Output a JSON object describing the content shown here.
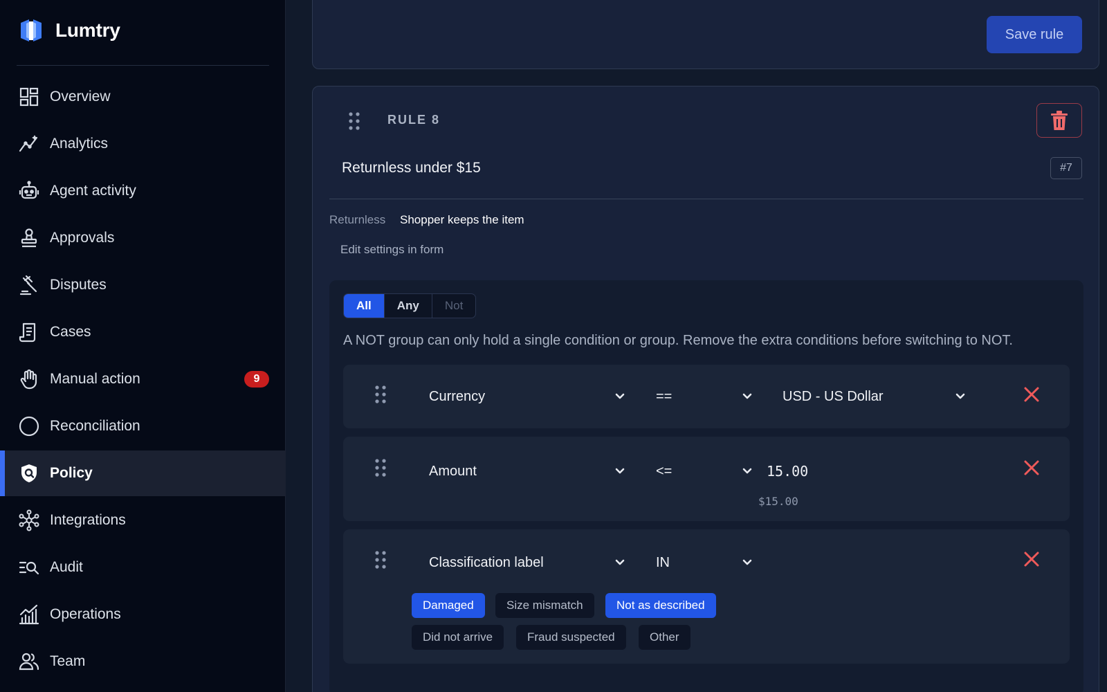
{
  "app": {
    "name": "Lumtry"
  },
  "nav": [
    {
      "label": "Overview",
      "icon": "overview-icon"
    },
    {
      "label": "Analytics",
      "icon": "analytics-icon"
    },
    {
      "label": "Agent activity",
      "icon": "robot-icon"
    },
    {
      "label": "Approvals",
      "icon": "stamp-icon"
    },
    {
      "label": "Disputes",
      "icon": "gavel-icon"
    },
    {
      "label": "Cases",
      "icon": "receipt-icon"
    },
    {
      "label": "Manual action",
      "icon": "hand-icon",
      "badge": "9"
    },
    {
      "label": "Reconciliation",
      "icon": "circle-icon"
    },
    {
      "label": "Policy",
      "icon": "shield-icon",
      "active": true
    },
    {
      "label": "Integrations",
      "icon": "network-icon"
    },
    {
      "label": "Audit",
      "icon": "audit-search-icon"
    },
    {
      "label": "Operations",
      "icon": "bar-chart-icon"
    },
    {
      "label": "Team",
      "icon": "users-icon"
    }
  ],
  "toolbar": {
    "save_label": "Save rule"
  },
  "rule": {
    "number_label": "RULE 8",
    "name": "Returnless under $15",
    "id_tag": "#7",
    "action_key": "Returnless",
    "action_value": "Shopper keeps the item",
    "edit_link": "Edit settings in form",
    "group_modes": [
      "All",
      "Any",
      "Not"
    ],
    "selected_mode": "All",
    "warning": "A NOT group can only hold a single condition or group. Remove the extra conditions before switching to NOT.",
    "conditions": [
      {
        "field": "Currency",
        "operator": "==",
        "value": "USD - US Dollar"
      },
      {
        "field": "Amount",
        "operator": "<=",
        "value": "15.00",
        "hint": "$15.00"
      },
      {
        "field": "Classification label",
        "operator": "IN",
        "chips": [
          {
            "label": "Damaged",
            "selected": true
          },
          {
            "label": "Size mismatch",
            "selected": false
          },
          {
            "label": "Not as described",
            "selected": true
          },
          {
            "label": "Did not arrive",
            "selected": false
          },
          {
            "label": "Fraud suspected",
            "selected": false
          },
          {
            "label": "Other",
            "selected": false
          }
        ]
      }
    ]
  },
  "colors": {
    "accent": "#2256e6",
    "sidebar_bg": "#050a17",
    "main_bg": "#111a2b",
    "danger": "#ef5a5a",
    "badge": "#c81e1e"
  }
}
